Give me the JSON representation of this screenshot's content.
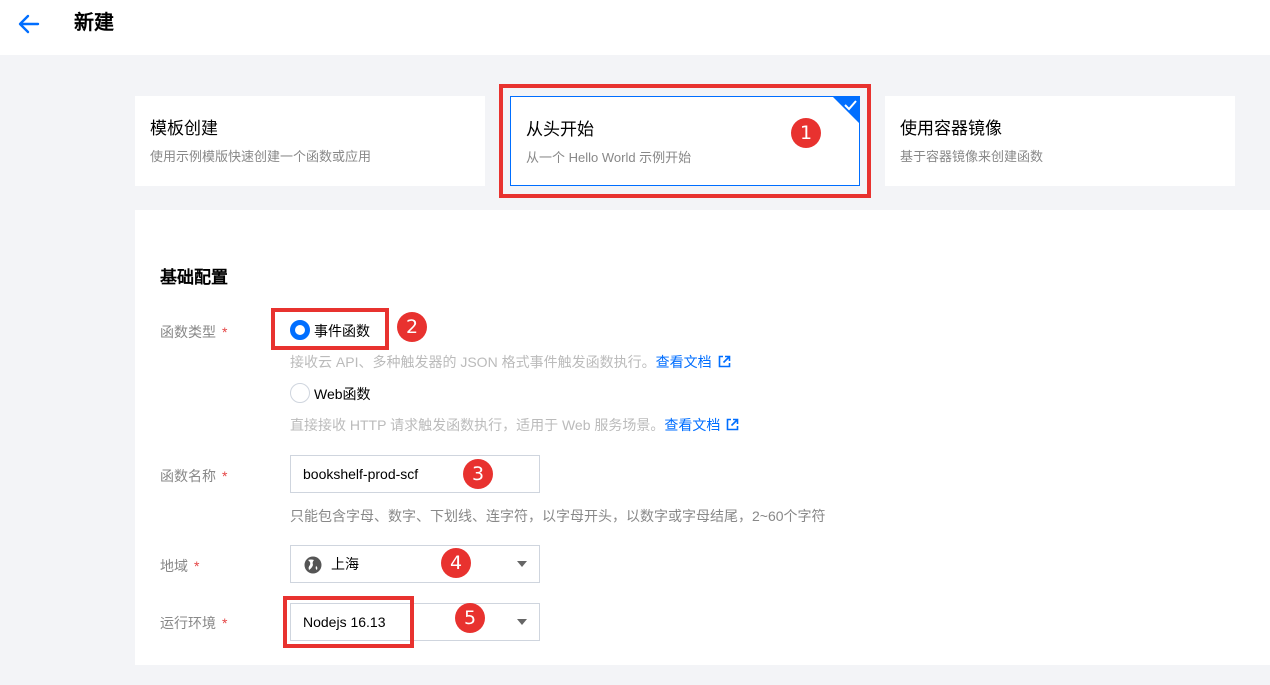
{
  "header": {
    "title": "新建"
  },
  "cards": [
    {
      "title": "模板创建",
      "desc": "使用示例模版快速创建一个函数或应用"
    },
    {
      "title": "从头开始",
      "desc": "从一个 Hello World 示例开始"
    },
    {
      "title": "使用容器镜像",
      "desc": "基于容器镜像来创建函数"
    }
  ],
  "form": {
    "section_title": "基础配置",
    "function_type": {
      "label": "函数类型",
      "required_mark": "*",
      "options": [
        {
          "label": "事件函数",
          "hint": "接收云 API、多种触发器的 JSON 格式事件触发函数执行。",
          "link": "查看文档",
          "selected": true
        },
        {
          "label": "Web函数",
          "hint": "直接接收 HTTP 请求触发函数执行，适用于 Web 服务场景。",
          "link": "查看文档",
          "selected": false
        }
      ]
    },
    "function_name": {
      "label": "函数名称",
      "required_mark": "*",
      "value": "bookshelf-prod-scf",
      "hint": "只能包含字母、数字、下划线、连字符，以字母开头，以数字或字母结尾，2~60个字符"
    },
    "region": {
      "label": "地域",
      "required_mark": "*",
      "value": "上海"
    },
    "runtime": {
      "label": "运行环境",
      "required_mark": "*",
      "value": "Nodejs 16.13"
    }
  },
  "annotations": [
    "1",
    "2",
    "3",
    "4",
    "5"
  ],
  "colors": {
    "accent": "#006eff",
    "annotation": "#e8322f"
  }
}
